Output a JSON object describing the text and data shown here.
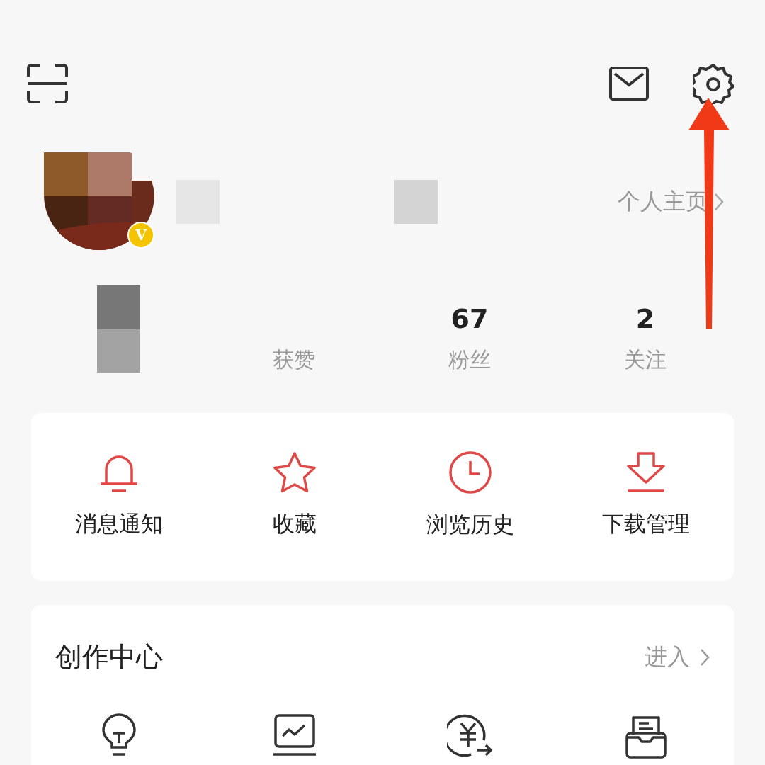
{
  "profile": {
    "verified_badge": "V",
    "home_link": "个人主页"
  },
  "stats": [
    {
      "label": "获赞"
    },
    {
      "value": "67",
      "label": "粉丝"
    },
    {
      "value": "2",
      "label": "关注"
    }
  ],
  "quick_actions": [
    {
      "label": "消息通知"
    },
    {
      "label": "收藏"
    },
    {
      "label": "浏览历史"
    },
    {
      "label": "下载管理"
    }
  ],
  "creator_center": {
    "title": "创作中心",
    "link": "进入"
  }
}
